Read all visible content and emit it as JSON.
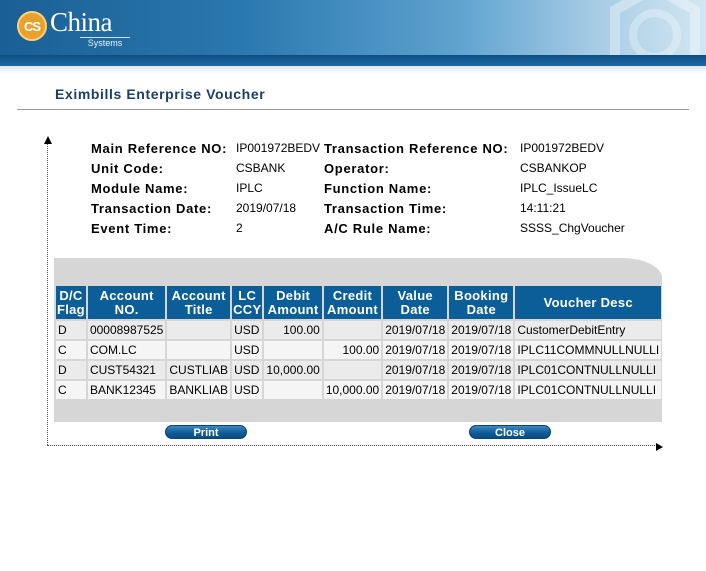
{
  "brand": {
    "badge": "CS",
    "name": "China",
    "sub": "Systems",
    "accent": "#0b5e97"
  },
  "page": {
    "title": "Eximbills Enterprise Voucher"
  },
  "info": [
    {
      "label": "Main Reference NO:",
      "value": "IP001972BEDV"
    },
    {
      "label": "Transaction Reference NO:",
      "value": "IP001972BEDV"
    },
    {
      "label": "Unit Code:",
      "value": "CSBANK"
    },
    {
      "label": "Operator:",
      "value": "CSBANKOP"
    },
    {
      "label": "Module Name:",
      "value": "IPLC"
    },
    {
      "label": "Function Name:",
      "value": "IPLC_IssueLC"
    },
    {
      "label": "Transaction Date:",
      "value": "2019/07/18"
    },
    {
      "label": "Transaction Time:",
      "value": "14:11:21"
    },
    {
      "label": "Event Time:",
      "value": "2"
    },
    {
      "label": "A/C Rule Name:",
      "value": "SSSS_ChgVoucher"
    }
  ],
  "table": {
    "headers": [
      [
        "D/C",
        "Flag"
      ],
      [
        "Account",
        "NO."
      ],
      [
        "Account",
        "Title"
      ],
      [
        "LC",
        "CCY"
      ],
      [
        "Debit",
        "Amount"
      ],
      [
        "Credit",
        "Amount"
      ],
      [
        "Value",
        "Date"
      ],
      [
        "Booking",
        "Date"
      ],
      [
        "Voucher Desc",
        ""
      ]
    ],
    "rows": [
      [
        "D",
        "00008987525",
        "",
        "USD",
        "100.00",
        "",
        "2019/07/18",
        "2019/07/18",
        "CustomerDebitEntry"
      ],
      [
        "C",
        "COM.LC",
        "",
        "USD",
        "",
        "100.00",
        "2019/07/18",
        "2019/07/18",
        "IPLC11COMMNULLNULLI"
      ],
      [
        "D",
        "CUST54321",
        "CUSTLIAB",
        "USD",
        "10,000.00",
        "",
        "2019/07/18",
        "2019/07/18",
        "IPLC01CONTNULLNULLI"
      ],
      [
        "C",
        "BANK12345",
        "BANKLIAB",
        "USD",
        "",
        "10,000.00",
        "2019/07/18",
        "2019/07/18",
        "IPLC01CONTNULLNULLI"
      ]
    ]
  },
  "buttons": {
    "print": "Print",
    "close": "Close"
  }
}
